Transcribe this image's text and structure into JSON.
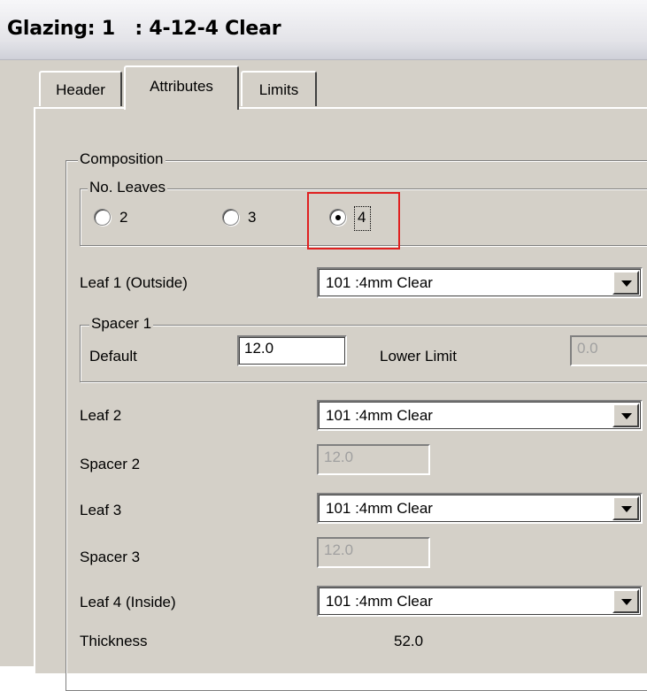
{
  "window": {
    "title": "Glazing: 1   : 4-12-4 Clear"
  },
  "tabs": [
    {
      "label": "Header",
      "active": false
    },
    {
      "label": "Attributes",
      "active": true
    },
    {
      "label": "Limits",
      "active": false
    }
  ],
  "composition": {
    "legend": "Composition",
    "no_leaves": {
      "legend": "No. Leaves",
      "options": [
        "2",
        "3",
        "4"
      ],
      "selected": "4"
    },
    "leaf1": {
      "label": "Leaf 1 (Outside)",
      "value": "101 :4mm Clear"
    },
    "spacer1": {
      "legend": "Spacer 1",
      "default_label": "Default",
      "default_value": "12.0",
      "lower_limit_label": "Lower Limit",
      "lower_limit_value": "0.0"
    },
    "leaf2": {
      "label": "Leaf 2",
      "value": "101 :4mm Clear"
    },
    "spacer2": {
      "label": "Spacer 2",
      "value": "12.0"
    },
    "leaf3": {
      "label": "Leaf 3",
      "value": "101 :4mm Clear"
    },
    "spacer3": {
      "label": "Spacer 3",
      "value": "12.0"
    },
    "leaf4": {
      "label": "Leaf 4 (Inside)",
      "value": "101 :4mm Clear"
    },
    "thickness": {
      "label": "Thickness",
      "value": "52.0"
    }
  },
  "colors": {
    "dialog_face": "#d4d0c8",
    "highlight_box": "#e02020"
  },
  "icons": {
    "dropdown": "chevron-down-icon"
  }
}
